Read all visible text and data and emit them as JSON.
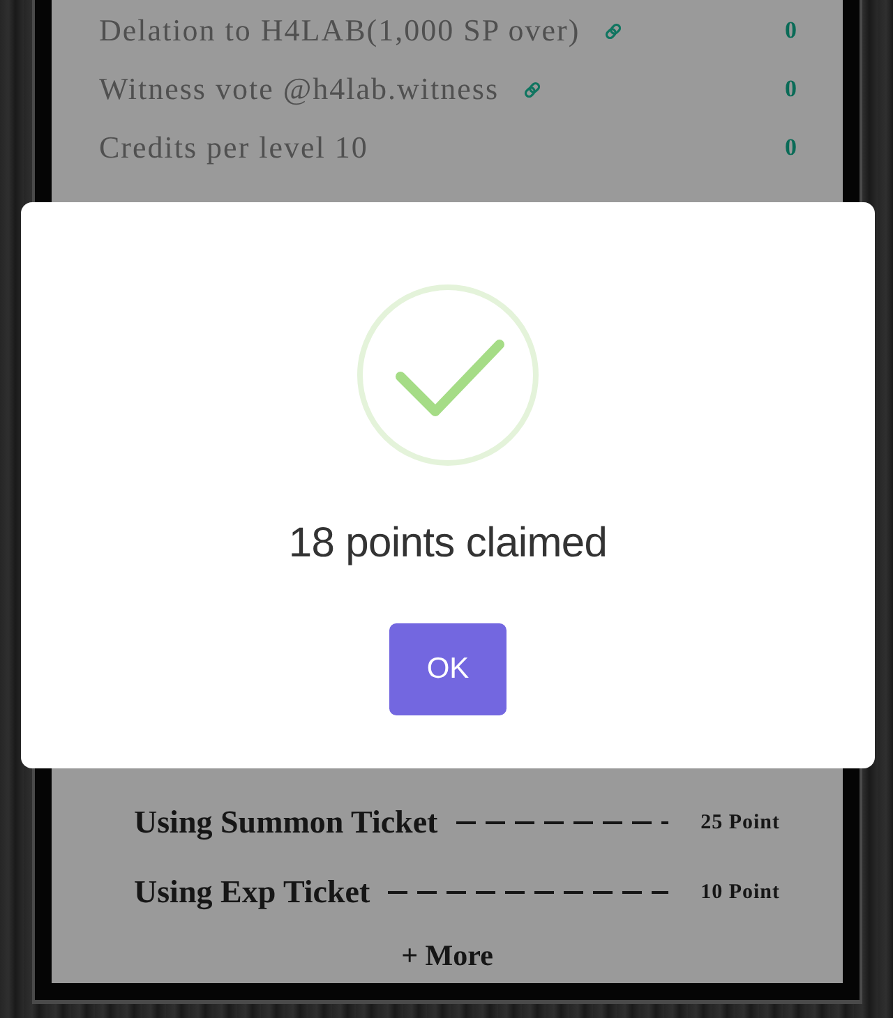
{
  "rewards": [
    {
      "label": "Delation to H4LAB(1,000 SP over)",
      "has_link": true,
      "value": "0"
    },
    {
      "label": "Witness vote @h4lab.witness",
      "has_link": true,
      "value": "0"
    },
    {
      "label": "Credits per level 10",
      "has_link": false,
      "value": "0"
    }
  ],
  "point_usage": [
    {
      "label": "Using Summon Ticket",
      "points": "25 Point"
    },
    {
      "label": "Using Exp Ticket",
      "points": "10 Point"
    }
  ],
  "more_link": {
    "label": "+ More"
  },
  "dialog": {
    "kind": "success",
    "message": "18 points claimed",
    "button": "OK"
  }
}
